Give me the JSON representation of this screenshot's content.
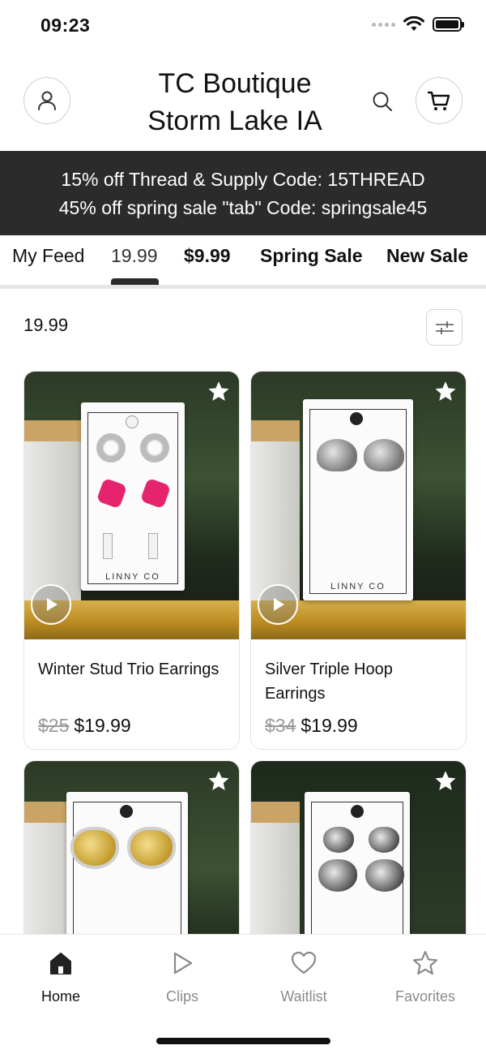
{
  "status_bar": {
    "time": "09:23"
  },
  "header": {
    "title_line1": "TC Boutique",
    "title_line2": "Storm Lake IA",
    "icons": [
      "person-icon",
      "search-icon",
      "cart-icon"
    ]
  },
  "promo": {
    "line1": "15% off Thread & Supply Code: 15THREAD",
    "line2": "45% off spring sale \"tab\" Code: springsale45"
  },
  "tabs": [
    {
      "label": "My Feed"
    },
    {
      "label": "19.99",
      "active": true
    },
    {
      "label": "$9.99"
    },
    {
      "label": "Spring Sale"
    },
    {
      "label": "New Sale"
    }
  ],
  "section": {
    "title": "19.99"
  },
  "products": [
    {
      "name": "Winter Stud Trio Earrings",
      "old_price": "$25",
      "price": "$19.99",
      "brand": "LINNY CO"
    },
    {
      "name": "Silver Triple Hoop Earrings",
      "old_price": "$34",
      "price": "$19.99",
      "brand": "LINNY CO"
    },
    {
      "name": "",
      "old_price": "",
      "price": ""
    },
    {
      "name": "",
      "old_price": "",
      "price": ""
    }
  ],
  "bottom_nav": [
    {
      "label": "Home",
      "icon": "home-icon",
      "active": true
    },
    {
      "label": "Clips",
      "icon": "play-icon"
    },
    {
      "label": "Waitlist",
      "icon": "heart-icon"
    },
    {
      "label": "Favorites",
      "icon": "star-icon"
    }
  ]
}
